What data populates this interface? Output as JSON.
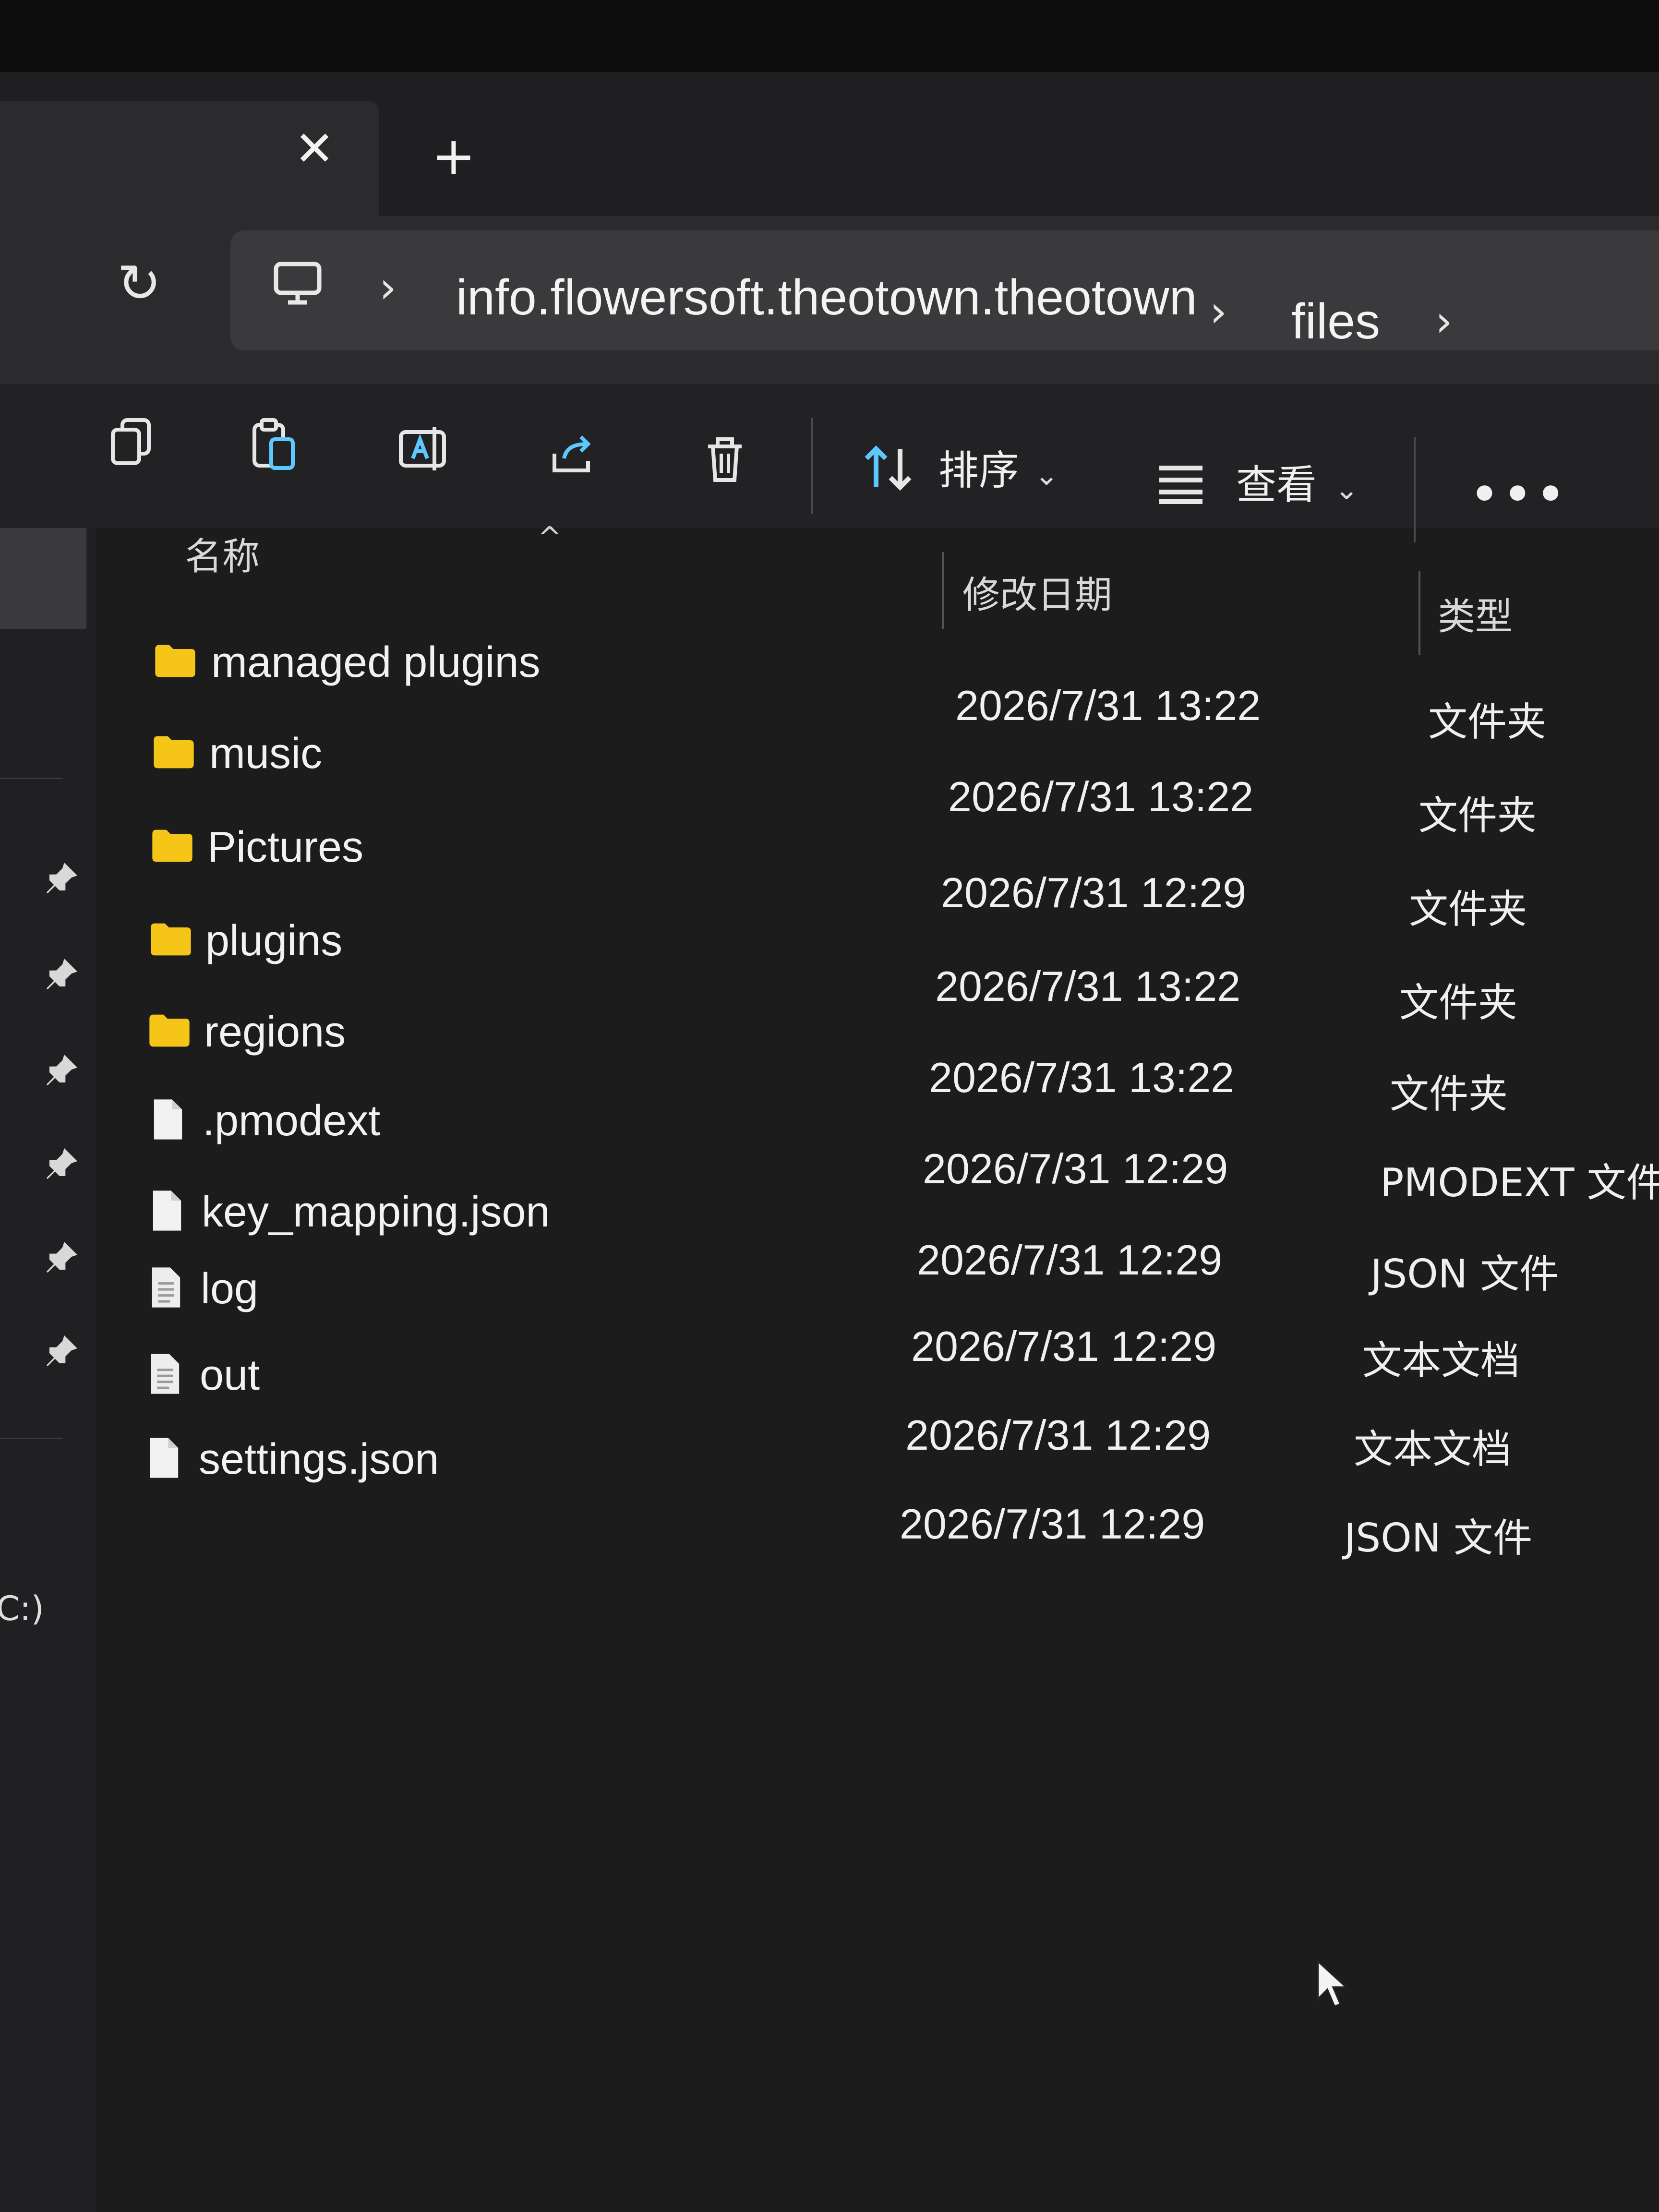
{
  "tabs": {
    "close_icon": "close-icon",
    "new_tab_icon": "plus-icon"
  },
  "address": {
    "crumbs": [
      "info.flowersoft.theotown.theotown",
      "files"
    ]
  },
  "toolbar": {
    "sort_label": "排序",
    "view_label": "查看",
    "icons": [
      "copy-icon",
      "paste-icon",
      "rename-icon",
      "share-icon",
      "delete-icon",
      "sort-icon",
      "view-icon",
      "more-icon"
    ]
  },
  "columns": {
    "name": "名称",
    "modified": "修改日期",
    "type": "类型"
  },
  "files": [
    {
      "name": "managed plugins",
      "modified": "2026/7/31 13:22",
      "type": "文件夹",
      "kind": "folder"
    },
    {
      "name": "music",
      "modified": "2026/7/31 13:22",
      "type": "文件夹",
      "kind": "folder"
    },
    {
      "name": "Pictures",
      "modified": "2026/7/31 12:29",
      "type": "文件夹",
      "kind": "folder"
    },
    {
      "name": "plugins",
      "modified": "2026/7/31 13:22",
      "type": "文件夹",
      "kind": "folder"
    },
    {
      "name": "regions",
      "modified": "2026/7/31 13:22",
      "type": "文件夹",
      "kind": "folder"
    },
    {
      "name": ".pmodext",
      "modified": "2026/7/31 12:29",
      "type": "PMODEXT 文件",
      "kind": "file"
    },
    {
      "name": "key_mapping.json",
      "modified": "2026/7/31 12:29",
      "type": "JSON 文件",
      "kind": "file"
    },
    {
      "name": "log",
      "modified": "2026/7/31 12:29",
      "type": "文本文档",
      "kind": "text"
    },
    {
      "name": "out",
      "modified": "2026/7/31 12:29",
      "type": "文本文档",
      "kind": "text"
    },
    {
      "name": "settings.json",
      "modified": "2026/7/31 12:29",
      "type": "JSON 文件",
      "kind": "file"
    }
  ],
  "sidebar": {
    "drive_label": "C:)"
  },
  "colors": {
    "folder": "#f5c518",
    "accent": "#5cc8ff",
    "background": "#1c1c1d"
  }
}
